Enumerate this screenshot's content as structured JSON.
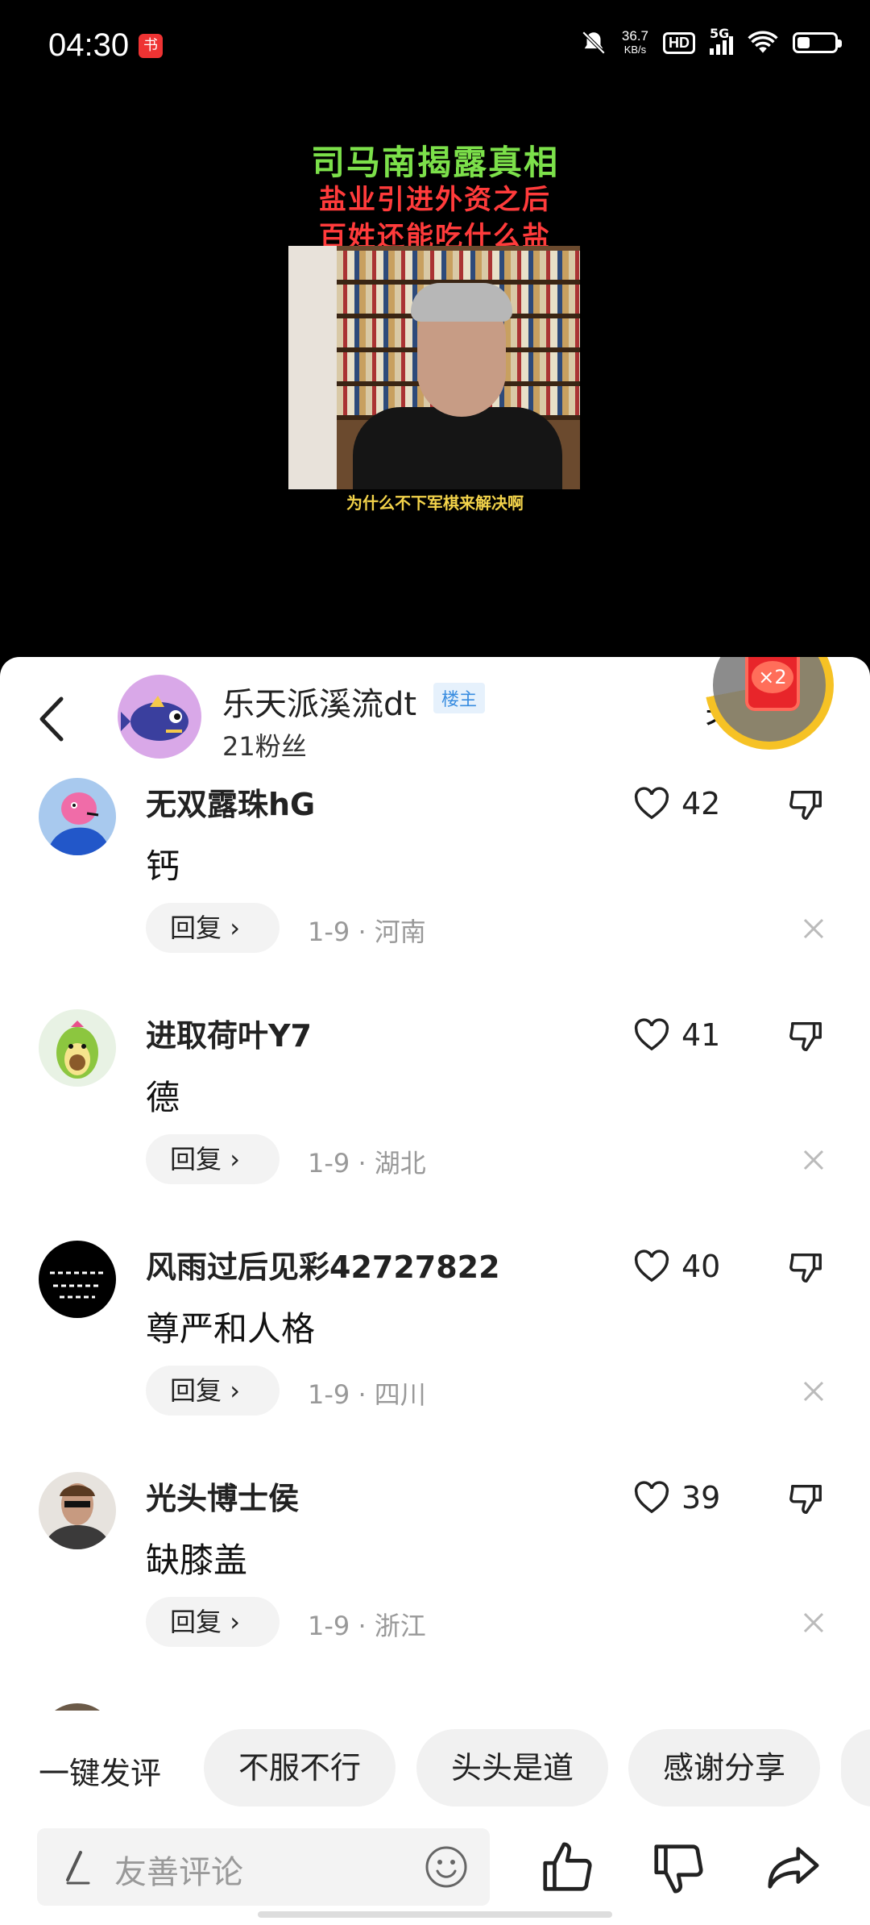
{
  "status_bar": {
    "time": "04:30",
    "app_badge_icon": "xiaohongshu-like-app-icon",
    "net_speed_value": "36.7",
    "net_speed_unit": "KB/s",
    "hd": "HD",
    "network": "5G"
  },
  "video": {
    "title_line1": "司马南揭露真相",
    "title_line2": "盐业引进外资之后",
    "title_line3": "百姓还能吃什么盐",
    "subtitle": "为什么不下军棋来解决啊"
  },
  "header": {
    "author_name": "乐天派溪流dt",
    "owner_tag": "楼主",
    "fans": "21粉丝",
    "follow_label": "关注",
    "redpack_label": "×2"
  },
  "comments": [
    {
      "name": "无双露珠hG",
      "text": "钙",
      "likes": "42",
      "reply": "回复",
      "date": "1-9",
      "location": "河南"
    },
    {
      "name": "进取荷叶Y7",
      "text": "德",
      "likes": "41",
      "reply": "回复",
      "date": "1-9",
      "location": "湖北"
    },
    {
      "name": "风雨过后见彩42727822",
      "text": "尊严和人格",
      "likes": "40",
      "reply": "回复",
      "date": "1-9",
      "location": "四川"
    },
    {
      "name": "光头博士侯",
      "text": "缺膝盖",
      "likes": "39",
      "reply": "回复",
      "date": "1-9",
      "location": "浙江"
    }
  ],
  "quick_reply": {
    "label": "一键发评",
    "chips": [
      "不服不行",
      "头头是道",
      "感谢分享"
    ]
  },
  "bottom_bar": {
    "placeholder": "友善评论"
  },
  "colors": {
    "accent_blue": "#3a8de0",
    "title_green": "#7ce04a",
    "title_red": "#ff3b3b",
    "ring_yellow": "#f6c225"
  }
}
